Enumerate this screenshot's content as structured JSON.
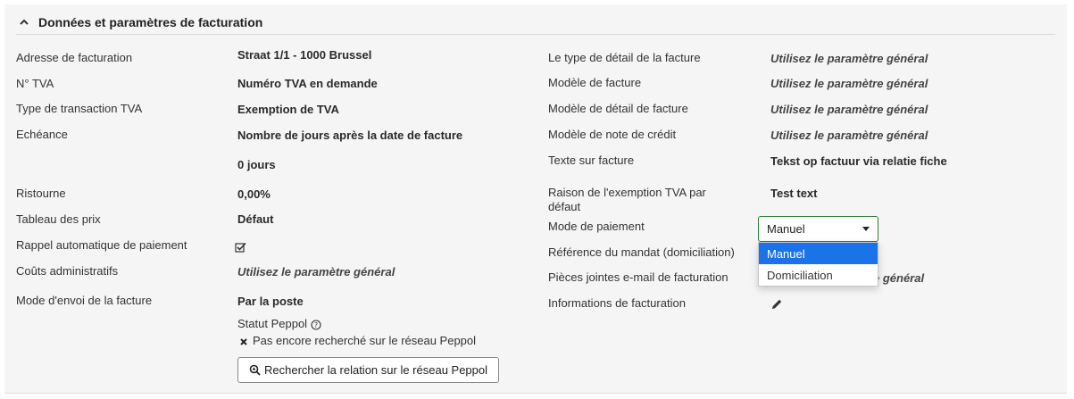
{
  "section": {
    "title": "Données et paramètres de facturation"
  },
  "left": [
    {
      "label": "Adresse de facturation",
      "value": "Straat 1/1 - 1000 Brussel"
    },
    {
      "label": "N° TVA",
      "value": "Numéro TVA en demande"
    },
    {
      "label": "Type de transaction TVA",
      "value": "Exemption de TVA"
    },
    {
      "label": "Echéance",
      "value": "Nombre de jours après la date de facture",
      "value2": "0 jours"
    },
    {
      "label": "Ristourne",
      "value": "0,00%"
    },
    {
      "label": "Tableau des prix",
      "value": "Défaut"
    },
    {
      "label": "Rappel automatique de paiement"
    },
    {
      "label": "Coûts administratifs",
      "value": "Utilisez le paramètre général"
    },
    {
      "label": "Mode d'envoi de la facture",
      "value": "Par la poste"
    }
  ],
  "peppol": {
    "status_label": "Statut Peppol",
    "status_value": "Pas encore recherché sur le réseau Peppol",
    "search_button": "Rechercher la relation sur le réseau Peppol"
  },
  "right": [
    {
      "label": "Le type de détail de la facture",
      "value": "Utilisez le paramètre général"
    },
    {
      "label": "Modèle de facture",
      "value": "Utilisez le paramètre général"
    },
    {
      "label": "Modèle de détail de facture",
      "value": "Utilisez le paramètre général"
    },
    {
      "label": "Modèle de note de crédit",
      "value": "Utilisez le paramètre général"
    },
    {
      "label": "Texte sur facture",
      "value": "Tekst op factuur via relatie fiche"
    },
    {
      "label": "Raison de l'exemption TVA par",
      "label2": "défaut",
      "value": "Test text"
    },
    {
      "label": "Mode de paiement"
    },
    {
      "label": "Référence du mandat (domiciliation)"
    },
    {
      "label": "Pièces jointes e-mail de facturation",
      "value_visible_part": "e général"
    },
    {
      "label": "Informations de facturation"
    }
  ],
  "payment_select": {
    "selected": "Manuel",
    "options": [
      "Manuel",
      "Domiciliation"
    ]
  },
  "colors": {
    "panel_bg": "#f5f5f5",
    "select_border": "#2e7d32",
    "option_selected": "#1a73e8"
  },
  "icons": [
    "chevron-up-icon",
    "checkbox-checked-icon",
    "help-circle-icon",
    "close-x-icon",
    "search-icon",
    "pencil-icon",
    "caret-down-icon"
  ]
}
